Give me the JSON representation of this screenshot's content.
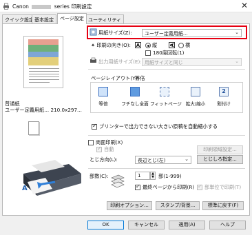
{
  "window": {
    "title_brand": "Canon",
    "title_rest": "series 印刷設定",
    "close_glyph": "✕"
  },
  "tabs": [
    {
      "label": "クイック設定"
    },
    {
      "label": "基本設定"
    },
    {
      "label": "ページ設定"
    },
    {
      "label": "ユーティリティ"
    }
  ],
  "left": {
    "paper_type": "普通紙",
    "paper_info": "ユーザー定義用紙... 210.0x297..."
  },
  "page_size": {
    "label": "用紙サイズ(Z):",
    "value": "ユーザー定義用紙..."
  },
  "orientation": {
    "label": "印刷の向き(O):",
    "portrait_label": "縦",
    "landscape_label": "横",
    "rotate_label": "180度回転(1)",
    "portrait_glyph": "A",
    "landscape_glyph": "A"
  },
  "output_size": {
    "label": "出力用紙サイズ(E):",
    "value": "用紙サイズと同じ"
  },
  "layout": {
    "label": "ページレイアウト(Y):",
    "value": "等倍",
    "options": [
      {
        "label": "等倍"
      },
      {
        "label": "フチなし全面"
      },
      {
        "label": "フィットページ"
      },
      {
        "label": "拡大/縮小"
      },
      {
        "label": "割付け"
      }
    ],
    "nup_badge": "2"
  },
  "reduce_checkbox": "プリンターで出力できない大きい原稿を自動縮小する",
  "duplex": {
    "label": "両面印刷(X)",
    "auto_label": "自動",
    "area_button": "印刷領域設定..."
  },
  "binding": {
    "label": "とじ方向(L):",
    "value": "長辺とじ(左)",
    "margin_button": "とじしろ指定..."
  },
  "copies": {
    "label": "部数(C):",
    "value": "1",
    "range": "部(1-999)",
    "reverse_label": "最終ページから印刷(R)",
    "collate_label": "部単位で印刷(T)"
  },
  "option_buttons": {
    "print_options": "印刷オプション...",
    "stamp": "スタンプ/背景...",
    "defaults": "標準に戻す(F)"
  },
  "footer": {
    "ok": "OK",
    "cancel": "キャンセル",
    "apply": "適用(A)",
    "help": "ヘルプ"
  }
}
